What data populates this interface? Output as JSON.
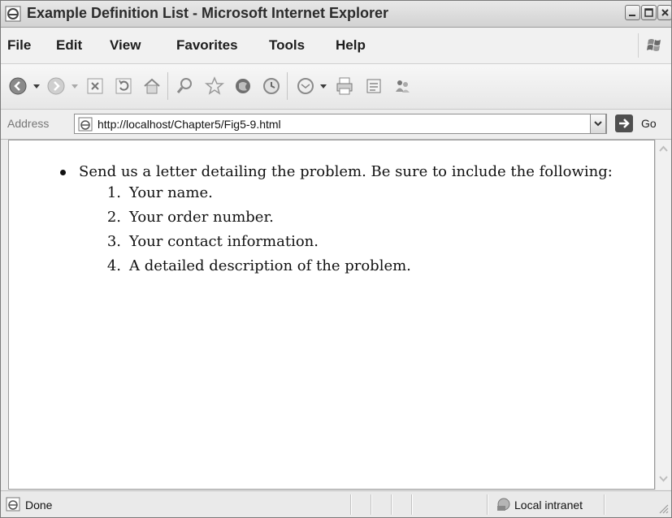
{
  "window": {
    "title": "Example Definition List - Microsoft Internet Explorer",
    "icons": {
      "app": "ie-globe-icon",
      "minimize": "minimize-icon",
      "maximize": "maximize-icon",
      "close": "close-icon"
    }
  },
  "menu": {
    "items": [
      "File",
      "Edit",
      "View",
      "Favorites",
      "Tools",
      "Help"
    ],
    "logo": "windows-flag-icon"
  },
  "toolbar": {
    "icons": [
      "back-icon",
      "forward-icon",
      "stop-icon",
      "refresh-icon",
      "home-icon",
      "search-icon",
      "favorites-star-icon",
      "media-icon",
      "history-icon",
      "mail-icon",
      "print-icon",
      "edit-icon",
      "messenger-icon"
    ]
  },
  "address": {
    "label": "Address",
    "url": "http://localhost/Chapter5/Fig5-9.html",
    "go_label": "Go"
  },
  "content": {
    "bullet": "Send us a letter detailing the problem. Be sure to include the following:",
    "list": [
      {
        "num": "1.",
        "text": "Your name."
      },
      {
        "num": "2.",
        "text": "Your order number."
      },
      {
        "num": "3.",
        "text": "Your contact information."
      },
      {
        "num": "4.",
        "text": "A detailed description of the problem."
      }
    ]
  },
  "status": {
    "text": "Done",
    "zone": "Local intranet"
  }
}
